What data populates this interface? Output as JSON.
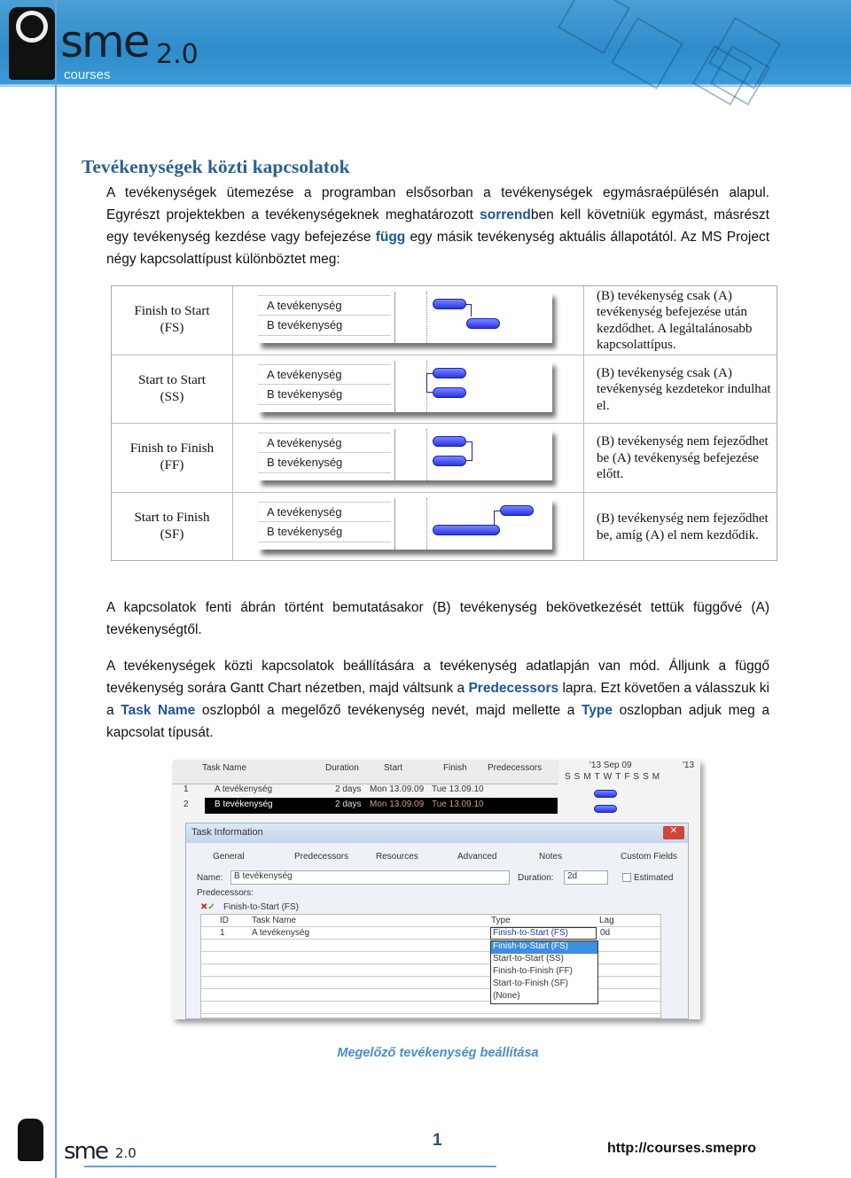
{
  "header": {
    "logo_text": "sme",
    "logo_version": "2.0",
    "logo_sub": "courses"
  },
  "title": "Tevékenységek közti kapcsolatok",
  "intro": {
    "p1": "A tevékenységek ütemezése a programban elsősorban a tevékenységek egymásraépülésén alapul. Egyrészt projektekben a tevékenységeknek meghatározott ",
    "kw1": "sorrend",
    "p2": "ben kell követniük egymást, másrészt egy tevékenység kezdése vagy befejezése ",
    "kw2": "függ",
    "p3": " egy másik tevékenység aktuális állapotától. Az MS Project négy kapcsolattípust különböztet meg:"
  },
  "relations": [
    {
      "name": "Finish to Start",
      "abbr": "(FS)",
      "desc": "(B) tevékenység csak (A) tevékenység befejezése után kezdődhet. A legáltalánosabb kapcsolattípus."
    },
    {
      "name": "Start to Start",
      "abbr": "(SS)",
      "desc": "(B) tevékenység csak (A) tevékenység kezdetekor indulhat el."
    },
    {
      "name": "Finish to Finish",
      "abbr": "(FF)",
      "desc": "(B) tevékenység nem fejeződhet be (A) tevékenység befejezése előtt."
    },
    {
      "name": "Start to Finish",
      "abbr": "(SF)",
      "desc": "(B) tevékenység nem fejeződhet be, amíg (A) el nem kezdődik."
    }
  ],
  "gantt_labels": {
    "a": "A tevékenység",
    "b": "B tevékenység"
  },
  "para2": "A kapcsolatok fenti ábrán történt bemutatásakor (B) tevékenység bekövetkezését tettük függővé (A) tevékenységtől.",
  "para3": {
    "t1": "A tevékenységek közti kapcsolatok beállítására a tevékenység adatlapján van mód. Álljunk a függő tevékenység sorára Gantt Chart nézetben, majd váltsunk a ",
    "kw1": "Predecessors",
    "t2": " lapra. Ezt követően a válasszuk ki a ",
    "kw2": "Task Name",
    "t3": " oszlopból a megelőző tevékenység nevét, majd mellette a ",
    "kw3": "Type",
    "t4": " oszlopban adjuk meg a kapcsolat típusát."
  },
  "screenshot": {
    "columns": [
      "Task Name",
      "Duration",
      "Start",
      "Finish",
      "Predecessors"
    ],
    "timescale": {
      "week": "'13 Sep 09",
      "next": "'13",
      "days": [
        "S",
        "S",
        "M",
        "T",
        "W",
        "T",
        "F",
        "S",
        "S",
        "M"
      ]
    },
    "rows": [
      {
        "id": "1",
        "name": "A tevékenység",
        "duration": "2 days",
        "start": "Mon 13.09.09",
        "finish": "Tue 13.09.10"
      },
      {
        "id": "2",
        "name": "B tevékenység",
        "duration": "2 days",
        "start": "Mon 13.09.09",
        "finish": "Tue 13.09.10"
      }
    ],
    "dialog": {
      "title": "Task Information",
      "tabs": [
        "General",
        "Predecessors",
        "Resources",
        "Advanced",
        "Notes",
        "Custom Fields"
      ],
      "name_label": "Name:",
      "name_value": "B tevékenység",
      "duration_label": "Duration:",
      "duration_value": "2d",
      "estimated_label": "Estimated",
      "predecessors_label": "Predecessors:",
      "edit_value": "Finish-to-Start (FS)",
      "grid_cols": [
        "ID",
        "Task Name",
        "Type",
        "Lag"
      ],
      "grid_row": {
        "id": "1",
        "task": "A tevékenység",
        "type": "Finish-to-Start (FS)",
        "lag": "0d"
      },
      "options": [
        "Finish-to-Start (FS)",
        "Start-to-Start (SS)",
        "Finish-to-Finish (FF)",
        "Start-to-Finish (SF)",
        "(None)"
      ]
    }
  },
  "caption": "Megelőző tevékenység beállítása",
  "footer": {
    "page": "1",
    "url": "http://courses.smepro",
    "logo_text": "sme",
    "logo_version": "2.0"
  }
}
